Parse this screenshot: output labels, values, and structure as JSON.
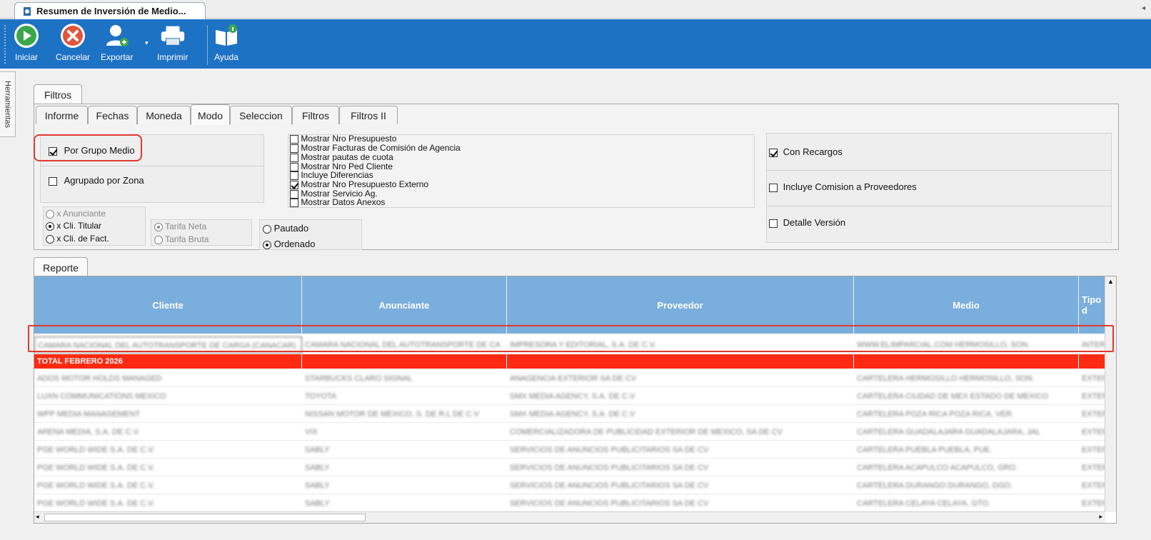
{
  "window": {
    "tab_title": "Resumen de Inversión de Medio...",
    "corner_arrow": "◂"
  },
  "toolbar": {
    "iniciar": "Iniciar",
    "cancelar": "Cancelar",
    "exportar": "Exportar",
    "imprimir": "Imprimir",
    "ayuda": "Ayuda"
  },
  "side_panel": {
    "label": "Herramientas"
  },
  "filtros": {
    "group_tab": "Filtros",
    "tabs": [
      "Informe",
      "Fechas",
      "Moneda",
      "Modo",
      "Seleccion",
      "Filtros",
      "Filtros II"
    ],
    "active_tab": "Modo"
  },
  "modo": {
    "por_grupo_medio": {
      "label": "Por Grupo Medio",
      "checked": true
    },
    "agrupado_por_zona": {
      "label": "Agrupado por Zona",
      "checked": false
    },
    "radio_cliente": [
      {
        "label": "x Anunciante",
        "selected": false,
        "disabled": true
      },
      {
        "label": "x Cli. Titular",
        "selected": true,
        "disabled": false
      },
      {
        "label": "x Cli. de Fact.",
        "selected": false,
        "disabled": false
      }
    ],
    "radio_tarifa": [
      {
        "label": "Tarifa Neta",
        "selected": true,
        "disabled": true
      },
      {
        "label": "Tarifa Bruta",
        "selected": false,
        "disabled": true
      }
    ],
    "radio_pauta": [
      {
        "label": "Pautado",
        "selected": false
      },
      {
        "label": "Ordenado",
        "selected": true
      }
    ],
    "opciones": [
      {
        "label": "Mostrar Nro Presupuesto",
        "checked": false
      },
      {
        "label": "Mostrar Facturas de Comisión de Agencia",
        "checked": false
      },
      {
        "label": "Mostrar pautas de cuota",
        "checked": false
      },
      {
        "label": "Mostrar Nro Ped Cliente",
        "checked": false
      },
      {
        "label": "Incluye Diferencias",
        "checked": false
      },
      {
        "label": "Mostrar Nro Presupuesto Externo",
        "checked": true
      },
      {
        "label": "Mostrar Servicio Ag.",
        "checked": false
      },
      {
        "label": "Mostrar Datos Anexos",
        "checked": false
      }
    ],
    "con_recargos": {
      "label": "Con Recargos",
      "checked": true
    },
    "incluye_comision": {
      "label": "Incluye Comision a Proveedores",
      "checked": false
    },
    "detalle_version": {
      "label": "Detalle Versión",
      "checked": false
    }
  },
  "reporte": {
    "tab": "Reporte",
    "columns": [
      "Cliente",
      "Anunciante",
      "Proveedor",
      "Medio",
      "Tipo d"
    ],
    "highlighted_row": [
      "CAMARA NACIONAL DEL AUTOTRANSPORTE DE CARGA (CANACAR)",
      "CAMARA NACIONAL DEL AUTOTRANSPORTE DE CA",
      "IMPRESORA Y EDITORIAL, S.A. DE C.V.",
      "WWW.ELIMPARCIAL.COM HERMOSILLO, SON.",
      "INTER"
    ],
    "total_row": [
      "TOTAL FEBRERO 2026",
      "",
      "",
      "",
      ""
    ],
    "rows": [
      [
        "ADOS MOTOR HOLDS MANAGED",
        "STARBUCKS CLARO SIGNAL",
        "ANAGENCIA EXTERIOR SA DE CV",
        "CARTELERA HERMOSILLO HERMOSILLO, SON.",
        "EXTERI"
      ],
      [
        "LUXN COMMUNICATIONS MEXICO",
        "TOYOTA",
        "SMX MEDIA AGENCY, S.A. DE C.V",
        "CARTELERA CIUDAD DE MEX ESTADO DE MEXICO",
        "EXTERI"
      ],
      [
        "WPP MEDIA MANAGEMENT",
        "NISSAN MOTOR DE MEXICO, S. DE R.L DE C.V",
        "SMX MEDIA AGENCY, S.A. DE C.V",
        "CARTELERA POZA RICA POZA RICA, VER.",
        "EXTERI"
      ],
      [
        "ARENA MEDIA, S.A. DE C.V.",
        "VIX",
        "COMERCIALIZADORA DE PUBLICIDAD EXTERIOR DE MEXICO, SA DE CV",
        "CARTELERA GUADALAJARA GUADALAJARA, JAL",
        "EXTERI"
      ],
      [
        "PGE WORLD WIDE S.A. DE C.V.",
        "SABLY",
        "SERVICIOS DE ANUNCIOS PUBLICITARIOS SA DE CV",
        "CARTELERA PUEBLA PUEBLA, PUE.",
        "EXTERI"
      ],
      [
        "PGE WORLD WIDE S.A. DE C.V.",
        "SABLY",
        "SERVICIOS DE ANUNCIOS PUBLICITARIOS SA DE CV",
        "CARTELERA ACAPULCO ACAPULCO, GRO.",
        "EXTERI"
      ],
      [
        "PGE WORLD WIDE S.A. DE C.V.",
        "SABLY",
        "SERVICIOS DE ANUNCIOS PUBLICITARIOS SA DE CV",
        "CARTELERA DURANGO DURANGO, DGO.",
        "EXTERI"
      ],
      [
        "PGE WORLD WIDE S.A. DE C.V.",
        "SABLY",
        "SERVICIOS DE ANUNCIOS PUBLICITARIOS SA DE CV",
        "CARTELERA CELAYA CELAYA, GTO.",
        "EXTERI"
      ]
    ]
  },
  "colors": {
    "toolbar": "#1e72c4",
    "header": "#7aaedc",
    "total_row": "#ff2a12",
    "highlight_box": "#e03a2e"
  }
}
